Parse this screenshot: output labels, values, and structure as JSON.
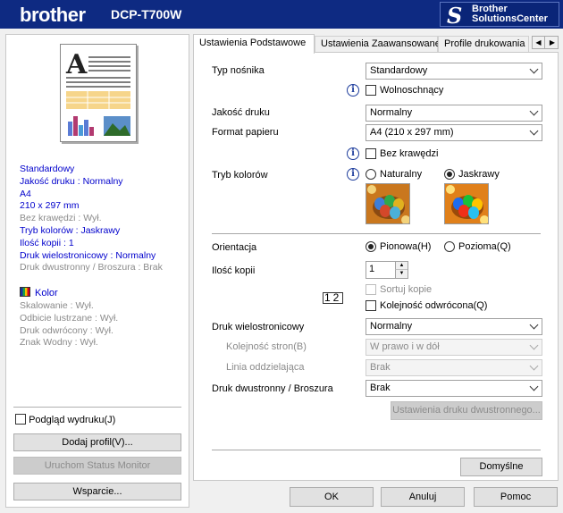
{
  "header": {
    "brand": "brother",
    "model": "DCP-T700W",
    "solutions_line1": "Brother",
    "solutions_line2": "SolutionsCenter"
  },
  "summary": {
    "lines_blue_1": [
      "Standardowy",
      "Jakość druku : Normalny",
      "A4",
      "210 x 297 mm"
    ],
    "line_gray_1": "Bez krawędzi : Wył.",
    "lines_blue_2": [
      "Tryb kolorów : Jaskrawy",
      "Ilość kopii   : 1",
      "Druk wielostronicowy   : Normalny"
    ],
    "line_gray_2": "Druk dwustronny / Broszura : Brak",
    "kolor_label": "Kolor",
    "lines_gray_3": [
      "Skalowanie : Wył.",
      "Odbicie lustrzane  : Wył.",
      "Druk odwrócony  : Wył.",
      "Znak Wodny : Wył."
    ]
  },
  "left": {
    "preview_checkbox": "Podgląd wydruku(J)",
    "preview_checked": false,
    "add_profile": "Dodaj profil(V)...",
    "status_monitor": "Uruchom Status Monitor",
    "support": "Wsparcie..."
  },
  "tabs": [
    "Ustawienia Podstawowe",
    "Ustawienia Zaawansowane",
    "Profile drukowania"
  ],
  "form": {
    "media_type_label": "Typ nośnika",
    "media_type_value": "Standardowy",
    "slow_drying": "Wolnoschnący",
    "quality_label": "Jakość druku",
    "quality_value": "Normalny",
    "paper_label": "Format papieru",
    "paper_value": "A4 (210 x 297 mm)",
    "borderless": "Bez krawędzi",
    "color_mode_label": "Tryb kolorów",
    "color_natural": "Naturalny",
    "color_vivid": "Jaskrawy",
    "orientation_label": "Orientacja",
    "portrait": "Pionowa(H)",
    "landscape": "Pozioma(Q)",
    "copies_label": "Ilość kopii",
    "copies_value": "1",
    "collate": "Sortuj kopie",
    "reverse": "Kolejność odwrócona(Q)",
    "collate_icon_text": "12",
    "multipage_label": "Druk wielostronicowy",
    "multipage_value": "Normalny",
    "page_order_label": "Kolejność stron(B)",
    "page_order_value": "W prawo i w dół",
    "border_line_label": "Linia oddzielająca",
    "border_line_value": "Brak",
    "duplex_label": "Druk dwustronny / Broszura",
    "duplex_value": "Brak",
    "duplex_settings": "Ustawienia druku dwustronnego...",
    "defaults": "Domyślne"
  },
  "buttons": {
    "ok": "OK",
    "cancel": "Anuluj",
    "help": "Pomoc"
  },
  "colors": {
    "banner": "#0e2a82",
    "link_blue": "#0000cc"
  }
}
